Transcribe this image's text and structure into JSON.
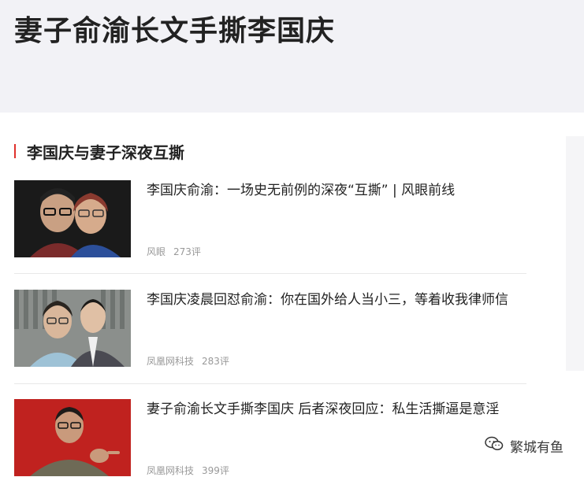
{
  "header": {
    "title": "妻子俞渝长文手撕李国庆"
  },
  "section": {
    "title": "李国庆与妻子深夜互撕"
  },
  "articles": [
    {
      "title": "李国庆俞渝：一场史无前例的深夜“互撕” | 风眼前线",
      "source": "风眼",
      "comments": "273评"
    },
    {
      "title": "李国庆凌晨回怼俞渝：你在国外给人当小三，等着收我律师信",
      "source": "凤凰网科技",
      "comments": "283评"
    },
    {
      "title": "妻子俞渝长文手撕李国庆 后者深夜回应：私生活撕逼是意淫",
      "source": "凤凰网科技",
      "comments": "399评"
    }
  ],
  "watermark": {
    "text": "繁城有鱼",
    "icon": "wechat-icon"
  },
  "colors": {
    "accent": "#e0312c",
    "banner_bg": "#f2f2f6",
    "title_text": "#222222",
    "meta_text": "#999999"
  }
}
